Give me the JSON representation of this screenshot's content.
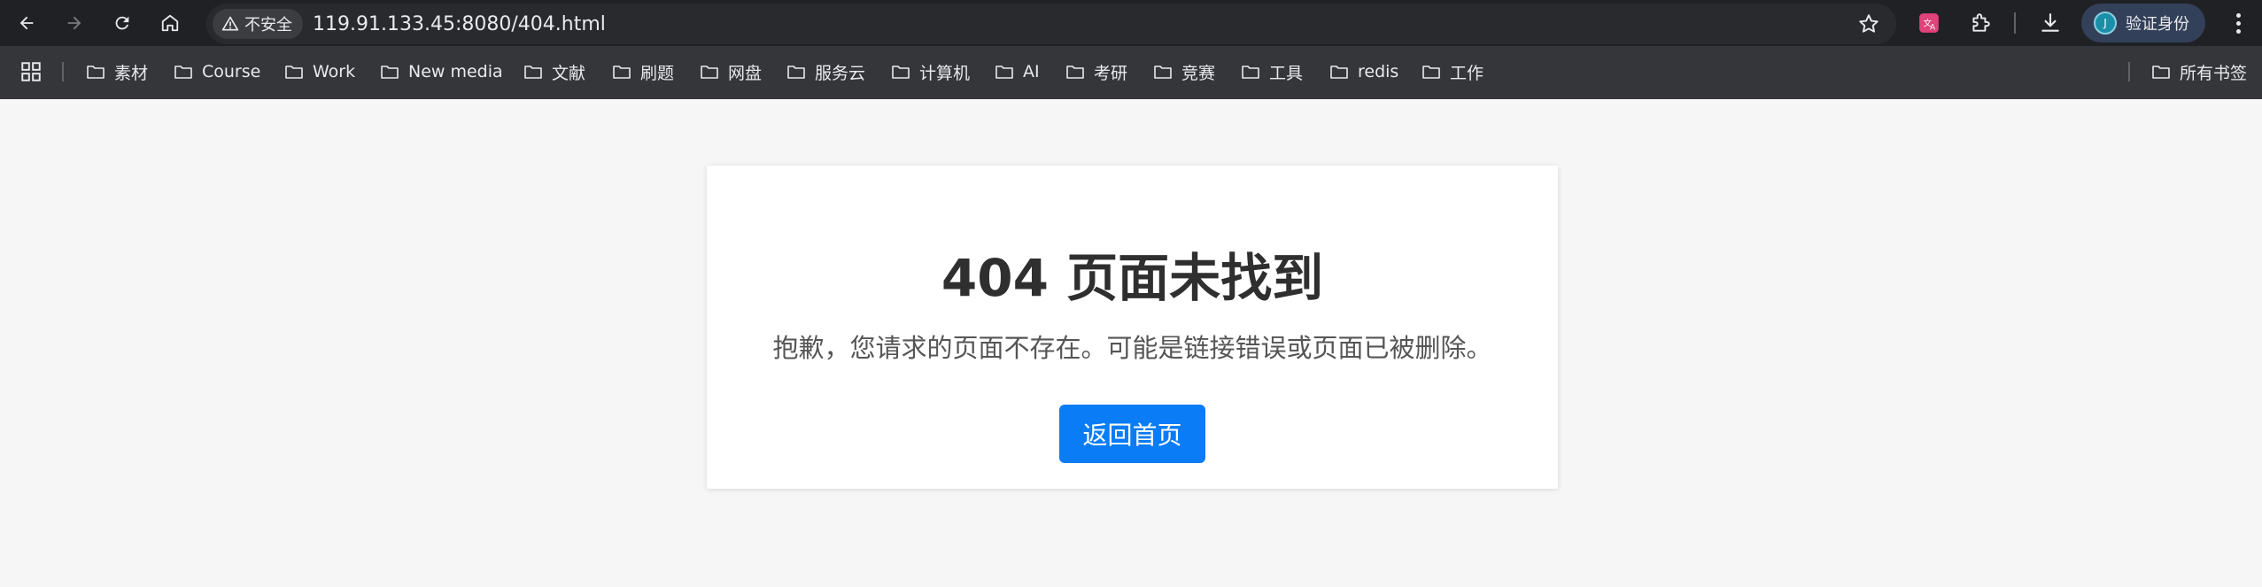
{
  "browser": {
    "security_label": "不安全",
    "url": "119.91.133.45:8080/404.html",
    "profile_label": "验证身份",
    "profile_initial": "J"
  },
  "bookmarks": {
    "items": [
      {
        "label": "素材"
      },
      {
        "label": "Course"
      },
      {
        "label": "Work"
      },
      {
        "label": "New media"
      },
      {
        "label": "文献"
      },
      {
        "label": "刷题"
      },
      {
        "label": "网盘"
      },
      {
        "label": "服务云"
      },
      {
        "label": "计算机"
      },
      {
        "label": "AI"
      },
      {
        "label": "考研"
      },
      {
        "label": "竞赛"
      },
      {
        "label": "工具"
      },
      {
        "label": "redis"
      },
      {
        "label": "工作"
      }
    ],
    "all_bookmarks_label": "所有书签"
  },
  "page": {
    "title": "404 页面未找到",
    "message": "抱歉，您请求的页面不存在。可能是链接错误或页面已被删除。",
    "home_button_label": "返回首页"
  },
  "colors": {
    "accent": "#0a7cf5",
    "toolbar_bg": "#202124",
    "bookmarks_bg": "#35363a",
    "page_bg": "#f6f6f6"
  }
}
